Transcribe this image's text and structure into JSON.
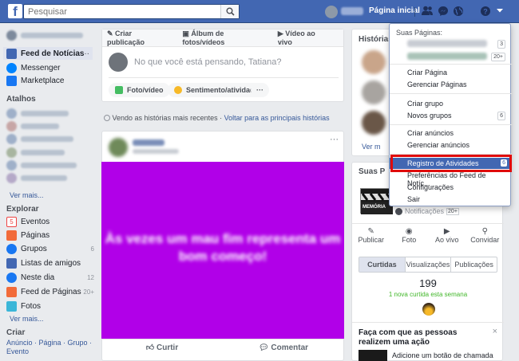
{
  "topbar": {
    "logo": "f",
    "search_placeholder": "Pesquisar",
    "home_label": "Página inicial"
  },
  "left_nav": {
    "main_items": [
      {
        "label": "Feed de Notícias",
        "icon": "news-feed-icon",
        "more": "···"
      },
      {
        "label": "Messenger",
        "icon": "messenger-icon"
      },
      {
        "label": "Marketplace",
        "icon": "marketplace-icon"
      }
    ],
    "shortcuts_title": "Atalhos",
    "see_more": "Ver mais...",
    "explore_title": "Explorar",
    "explore_items": [
      {
        "label": "Eventos",
        "icon": "calendar-icon",
        "icon_text": "5",
        "count": ""
      },
      {
        "label": "Páginas",
        "icon": "flag-icon",
        "count": ""
      },
      {
        "label": "Grupos",
        "icon": "groups-icon",
        "count": "6"
      },
      {
        "label": "Listas de amigos",
        "icon": "friend-lists-icon",
        "count": ""
      },
      {
        "label": "Neste dia",
        "icon": "on-this-day-icon",
        "count": "12"
      },
      {
        "label": "Feed de Páginas",
        "icon": "pages-feed-icon",
        "count": "20+"
      },
      {
        "label": "Fotos",
        "icon": "photos-icon",
        "count": ""
      }
    ],
    "create_title": "Criar",
    "create_links": "Anúncio · Página · Grupo · Evento"
  },
  "composer": {
    "tabs": [
      "Criar publicação",
      "Álbum de fotos/vídeos",
      "Vídeo ao vivo"
    ],
    "placeholder": "No que você está pensando, Tatiana?",
    "actions": [
      "Foto/vídeo",
      "Sentimento/atividade"
    ],
    "more": "···"
  },
  "stories_notice": {
    "text": "Vendo as histórias mais recentes · ",
    "link": "Voltar para as principais histórias"
  },
  "post": {
    "image_text": "Às vezes um mau fim representa um bom começo!",
    "image_color": "#b100e8",
    "actions": [
      "Curtir",
      "Comentar"
    ],
    "menu": "···"
  },
  "right_column": {
    "stories_title": "Histórias",
    "see_more": "Ver m",
    "pages_title": "Suas P",
    "page_name": "MEMÓRIA",
    "notifications_label": "Notificações",
    "notifications_count": "20+",
    "page_actions": [
      "Publicar",
      "Foto",
      "Ao vivo",
      "Convidar"
    ],
    "tabs": [
      "Curtidas",
      "Visualizações",
      "Publicações"
    ],
    "likes_count": "199",
    "likes_week": "1 nova curtida esta semana",
    "promo_title": "Faça com que as pessoas realizem uma ação",
    "promo_text": "Adicione um botão de chamada",
    "close": "×"
  },
  "dropdown": {
    "your_pages_header": "Suas Páginas:",
    "page_counts": [
      "3",
      "20+"
    ],
    "items_group1": [
      "Criar Página",
      "Gerenciar Páginas"
    ],
    "items_group2": [
      "Criar grupo",
      "Novos grupos"
    ],
    "new_groups_count": "6",
    "items_group3": [
      "Criar anúncios",
      "Gerenciar anúncios"
    ],
    "selected_item": "Registro de Atividades",
    "selected_badge": "6",
    "items_group4": [
      "Preferências do Feed de Notíc...",
      "Configurações",
      "Sair"
    ]
  },
  "colors": {
    "brand": "#4267b2",
    "highlight": "#e00b0b"
  }
}
